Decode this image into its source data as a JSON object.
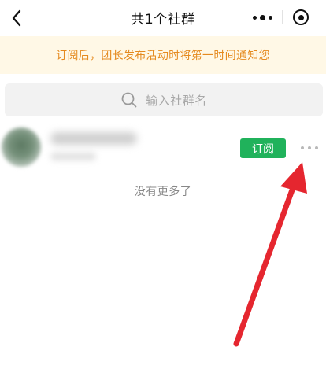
{
  "navbar": {
    "title": "共1个社群",
    "back_icon": "chevron-left-icon",
    "more_icon": "more-dots-icon",
    "close_icon": "target-circle-icon"
  },
  "notice": {
    "text": "订阅后，团长发布活动时将第一时间通知您",
    "color": "#e58a1f",
    "background": "#fff8e6"
  },
  "search": {
    "placeholder": "输入社群名",
    "icon": "search-icon"
  },
  "groups": [
    {
      "subscribe_label": "订阅",
      "subscribe_color": "#20b25b",
      "more_icon": "ellipsis-icon"
    }
  ],
  "footer": {
    "no_more_text": "没有更多了"
  },
  "annotation": {
    "color": "#e5262f"
  }
}
